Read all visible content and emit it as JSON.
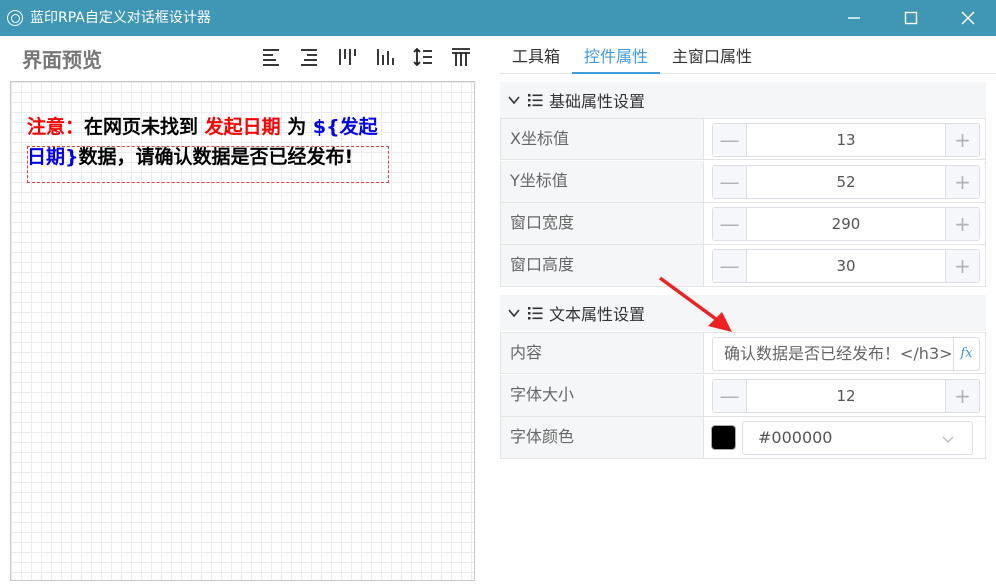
{
  "window": {
    "title": "蓝印RPA自定义对话框设计器",
    "icon": "app-logo-icon"
  },
  "preview": {
    "title": "界面预览",
    "toolbar_icons": [
      "align-left-icon",
      "align-right-icon",
      "align-top-icon",
      "align-bottom-icon",
      "same-height-icon",
      "distribute-vertical-icon"
    ],
    "canvas_text": {
      "part1": "注意：",
      "part2": "在网页未找到 ",
      "part3": "发起日期",
      "part4": " 为 ",
      "part5": "${发起日期}",
      "part6": "数据，请确认数据是否已经发布!"
    }
  },
  "tabs": [
    {
      "label": "工具箱",
      "active": false
    },
    {
      "label": "控件属性",
      "active": true
    },
    {
      "label": "主窗口属性",
      "active": false
    }
  ],
  "basic_section": {
    "title": "基础属性设置",
    "rows": [
      {
        "label": "X坐标值",
        "value": "13"
      },
      {
        "label": "Y坐标值",
        "value": "52"
      },
      {
        "label": "窗口宽度",
        "value": "290"
      },
      {
        "label": "窗口高度",
        "value": "30"
      }
    ]
  },
  "text_section": {
    "title": "文本属性设置",
    "content_label": "内容",
    "content_value": "确认数据是否已经发布！</h3>",
    "fx_label": "fx",
    "font_size_label": "字体大小",
    "font_size_value": "12",
    "font_color_label": "字体颜色",
    "font_color_value": "#000000"
  },
  "colors": {
    "titlebar": "#3f96b5",
    "accent": "#3f9ae0",
    "arrow": "#ee2222"
  }
}
